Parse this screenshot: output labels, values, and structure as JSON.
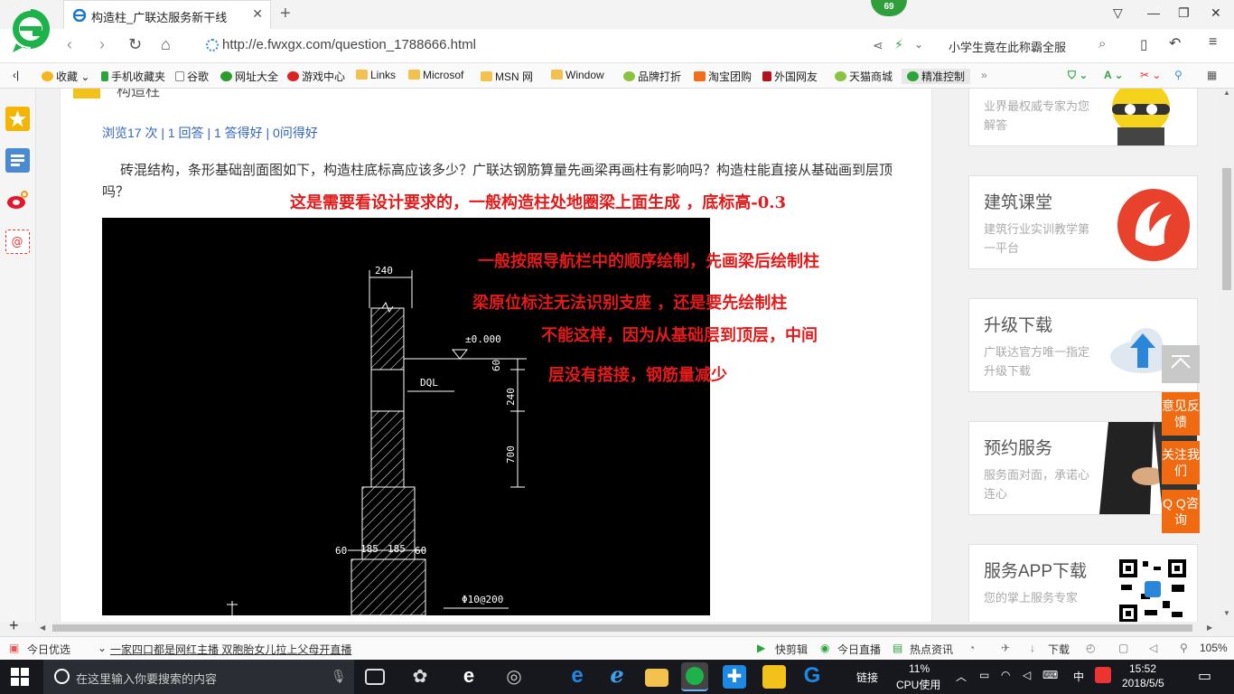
{
  "browser": {
    "tab_title": "构造柱_广联达服务新干线",
    "badge": "69",
    "url": "http://e.fwxgx.com/question_1788666.html",
    "search_hint": "小学生竟在此称霸全服"
  },
  "favorites": [
    "收藏",
    "手机收藏夹",
    "谷歌",
    "网址大全",
    "游戏中心",
    "Links",
    "Microsof",
    "MSN 网",
    "Window",
    "品牌打折",
    "淘宝团购",
    "外国网友",
    "天猫商城",
    "精准控制"
  ],
  "page": {
    "top_title": "构造柱",
    "stats": "浏览17 次 | 1 回答 | 1 答得好 | 0问得好",
    "question": "砖混结构，条形基础剖面图如下，构造柱底标高应该多少？广联达钢筋算量先画梁再画柱有影响吗？构造柱能直接从基础画到层顶吗？",
    "annotations": {
      "a1": "这是需要看设计要求的，一般构造柱处地圈梁上面生成 ，底标高-0.3",
      "a2": "一般按照导航栏中的顺序绘制，先画梁后绘制柱",
      "a3": "梁原位标注无法识别支座 ，还是要先绘制柱",
      "a4": "不能这样，因为从基础层到顶层，中间",
      "a5": "层没有搭接，钢筋量减少"
    },
    "cad_labels": {
      "w240": "240",
      "elev": "±0.000",
      "dql": "DQL",
      "d60": "60",
      "d240": "240",
      "d700": "700",
      "b60l": "60",
      "b185l": "185",
      "b185r": "185",
      "b60r": "60",
      "rebar": "Φ10@200"
    }
  },
  "sidebar_cards": [
    {
      "subtitle": "业界最权威专家为您解答"
    },
    {
      "title": "建筑课堂",
      "subtitle": "建筑行业实训教学第一平台"
    },
    {
      "title": "升级下载",
      "subtitle": "广联达官方唯一指定升级下载"
    },
    {
      "title": "预约服务",
      "subtitle": "服务面对面，承诺心连心"
    },
    {
      "title": "服务APP下载",
      "subtitle": "您的掌上服务专家"
    }
  ],
  "float_buttons": {
    "feedback": "意见反馈",
    "follow": "关注我们",
    "qq": "Q Q咨询"
  },
  "statusbar": {
    "today": "今日优选",
    "news": "一家四口都是网红主播 双胞胎女儿拉上父母开直播",
    "kuaijian": "快剪辑",
    "live": "今日直播",
    "hot": "热点资讯",
    "download": "下载",
    "zoom": "105%"
  },
  "taskbar": {
    "search_placeholder": "在这里输入你要搜索的内容",
    "link": "链接",
    "cpu": "11%",
    "cpu_label": "CPU使用",
    "ime": "中",
    "time": "15:52",
    "date": "2018/5/5"
  },
  "colors": {
    "annotation": "#e21a1a",
    "accent_orange": "#f06a12",
    "link_blue": "#3366bb"
  }
}
